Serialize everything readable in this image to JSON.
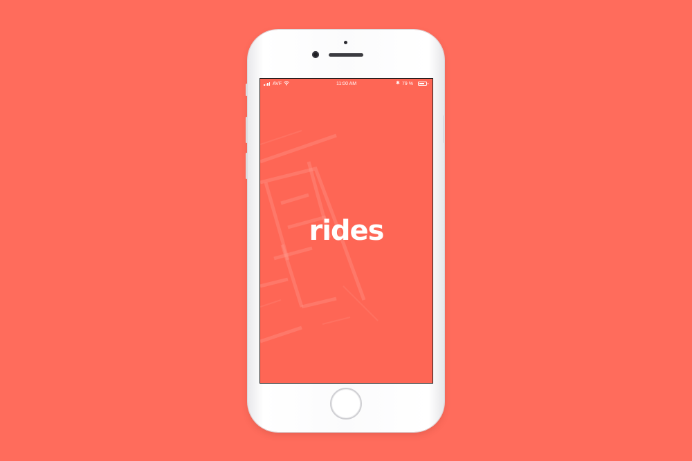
{
  "device": {
    "model": "iPhone",
    "home_button_icon": "home-button"
  },
  "status_bar": {
    "carrier": "AVF",
    "time": "11:00 AM",
    "battery_text": "79 %",
    "battery_level": 0.79,
    "icons": [
      "signal-bars-icon",
      "wifi-icon",
      "bluetooth-icon",
      "battery-icon"
    ]
  },
  "app": {
    "logo_text": "rides"
  },
  "colors": {
    "background": "#ff6c5c",
    "screen": "#fe6655",
    "text": "#ffffff"
  }
}
